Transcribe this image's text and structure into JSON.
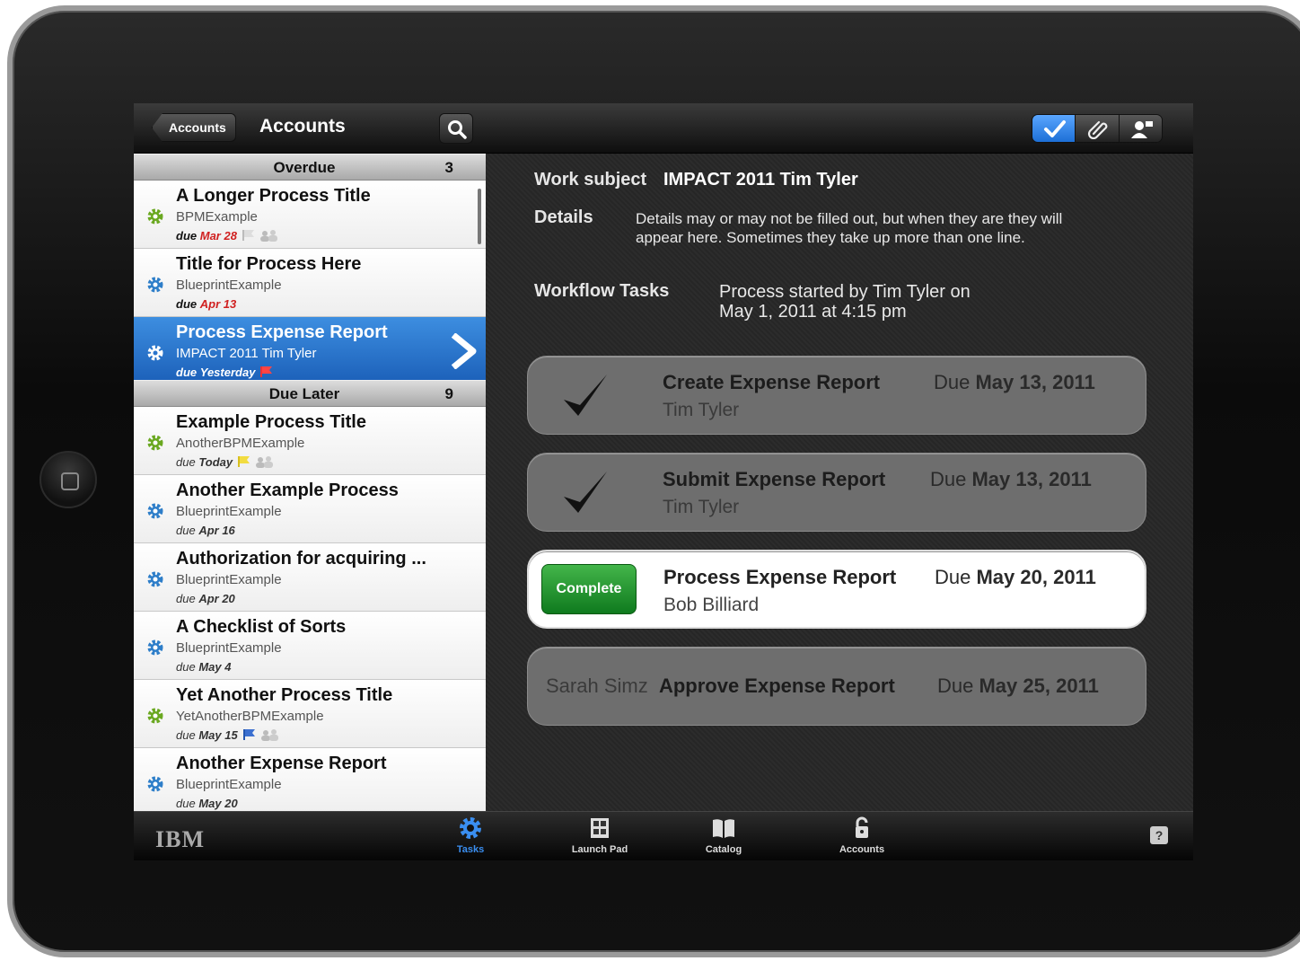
{
  "left_panel": {
    "back_label": "Accounts",
    "title": "Accounts",
    "sections": [
      {
        "title": "Overdue",
        "count": "3"
      },
      {
        "title": "Due Later",
        "count": "9"
      }
    ],
    "tasks": [
      {
        "title": "A Longer Process Title",
        "app": "BPMExample",
        "due_prefix": "due",
        "due": "Mar 28",
        "flag": "gray"
      },
      {
        "title": "Title for Process Here",
        "app": "BlueprintExample",
        "due_prefix": "due",
        "due": "Apr 13"
      },
      {
        "title": "Process Expense Report",
        "app": "IMPACT 2011 Tim Tyler",
        "due_prefix": "due",
        "due": "Yesterday",
        "flag": "red"
      },
      {
        "title": "Example Process Title",
        "app": "AnotherBPMExample",
        "due_prefix": "due",
        "due": "Today",
        "flag": "yellow"
      },
      {
        "title": "Another Example Process",
        "app": "BlueprintExample",
        "due_prefix": "due",
        "due": "Apr 16"
      },
      {
        "title": "Authorization for acquiring ...",
        "app": "BlueprintExample",
        "due_prefix": "due",
        "due": "Apr 20"
      },
      {
        "title": "A Checklist of Sorts",
        "app": "BlueprintExample",
        "due_prefix": "due",
        "due": "May 4"
      },
      {
        "title": "Yet Another Process Title",
        "app": "YetAnotherBPMExample",
        "due_prefix": "due",
        "due": "May 15",
        "flag": "blue"
      },
      {
        "title": "Another Expense Report",
        "app": "BlueprintExample",
        "due_prefix": "due",
        "due": "May 20"
      }
    ]
  },
  "detail": {
    "work_subject_label": "Work subject",
    "work_subject_value": "IMPACT 2011 Tim Tyler",
    "details_label": "Details",
    "details_text_1": "Details may or may not be filled out, but when they are they will",
    "details_text_2": "appear here. Sometimes they take up more than one line.",
    "workflow_label": "Workflow Tasks",
    "workflow_text_1": "Process started by Tim Tyler on",
    "workflow_text_2": "May 1, 2011 at 4:15 pm",
    "cards": [
      {
        "title": "Create Expense Report",
        "person": "Tim Tyler",
        "due_prefix": "Due",
        "due": "May 13, 2011",
        "status": "done"
      },
      {
        "title": "Submit Expense Report",
        "person": "Tim Tyler",
        "due_prefix": "Due",
        "due": "May 13, 2011",
        "status": "done"
      },
      {
        "title": "Process Expense Report",
        "person": "Bob Billiard",
        "due_prefix": "Due",
        "due": "May 20, 2011",
        "status": "active",
        "action": "Complete"
      },
      {
        "title": "Approve Expense Report",
        "person": "Sarah Simz",
        "due_prefix": "Due",
        "due": "May 25, 2011",
        "status": "pending"
      }
    ]
  },
  "tabbar": {
    "logo": "IBM",
    "tabs": [
      {
        "label": "Tasks",
        "icon": "gear-icon",
        "active": true
      },
      {
        "label": "Launch Pad",
        "icon": "grid-icon"
      },
      {
        "label": "Catalog",
        "icon": "book-icon"
      },
      {
        "label": "Accounts",
        "icon": "lock-icon"
      }
    ],
    "help": "?"
  },
  "colors": {
    "selected_row": "#2a74cc",
    "complete_button": "#1f9a2e",
    "overdue_date": "#d02020"
  }
}
